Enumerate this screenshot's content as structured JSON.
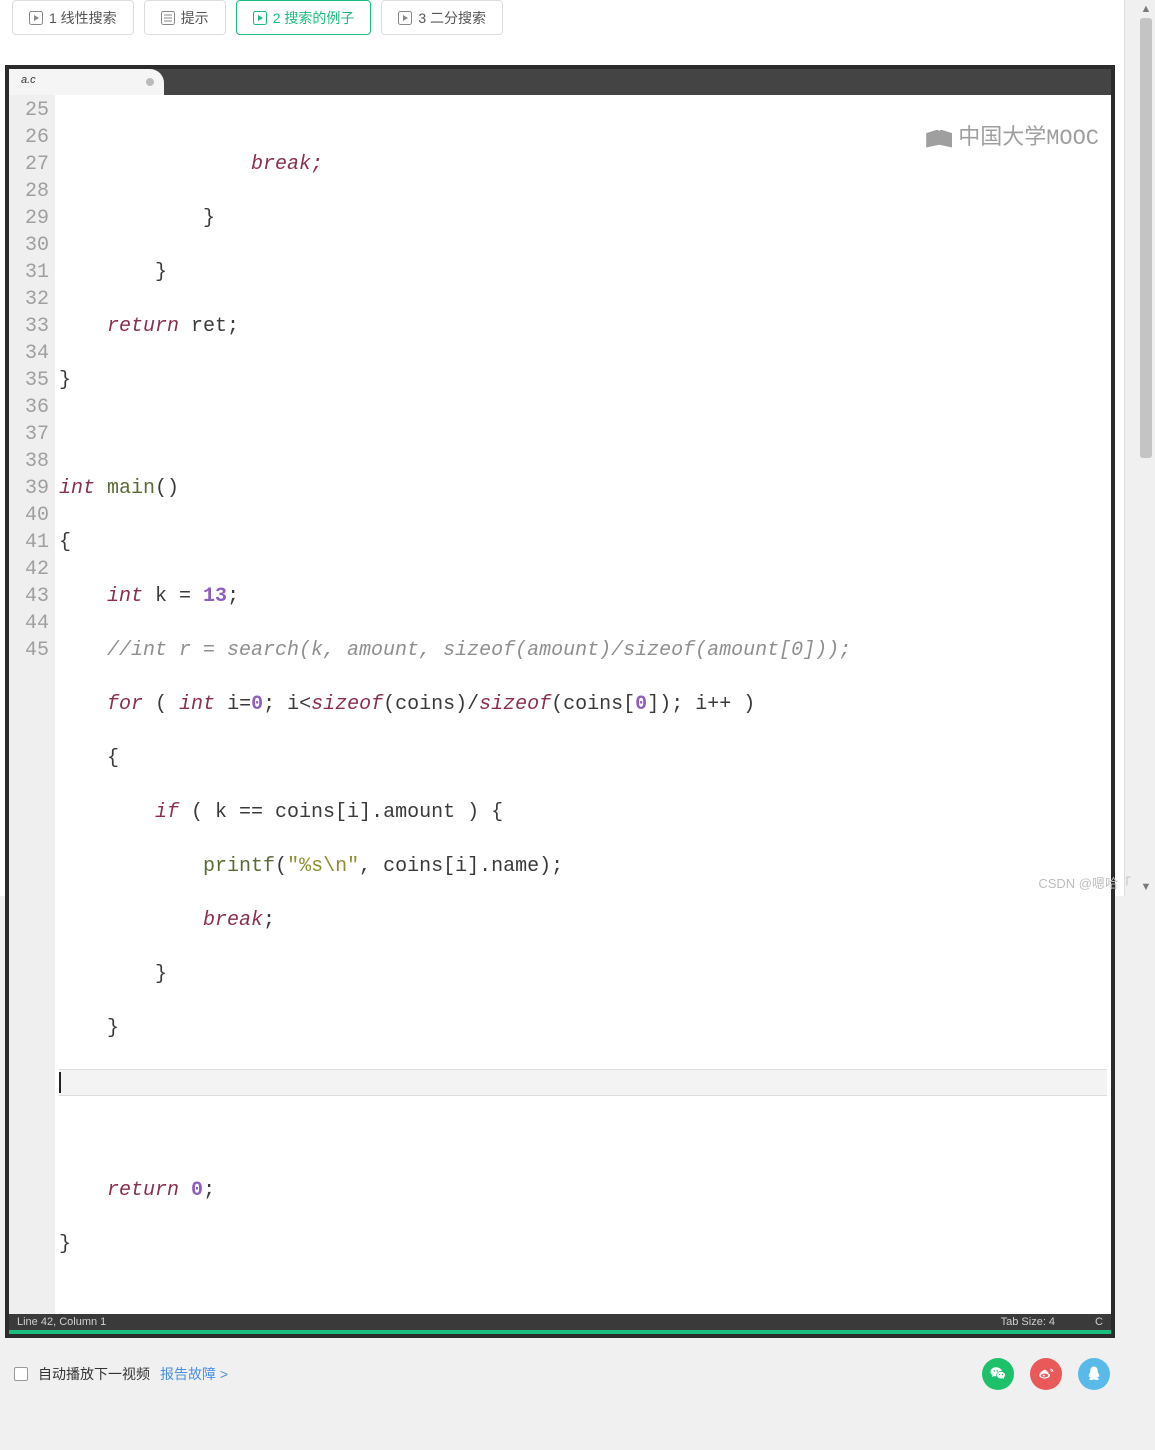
{
  "tabs": [
    {
      "label": "1 线性搜索",
      "kind": "play",
      "active": false
    },
    {
      "label": "提示",
      "kind": "list",
      "active": false
    },
    {
      "label": "2 搜索的例子",
      "kind": "play",
      "active": true
    },
    {
      "label": "3 二分搜索",
      "kind": "play",
      "active": false
    }
  ],
  "editor": {
    "tab_name": "a.c",
    "line_start": 25,
    "line_end": 45,
    "cursor_line": 42,
    "watermark": "中国大学MOOC",
    "status_left": "Line 42, Column 1",
    "status_tab": "Tab Size: 4",
    "status_lang": "C",
    "code": {
      "l25": "                break;",
      "l26": "            }",
      "l27": "        }",
      "l28_a": "    ",
      "l28_kw": "return",
      "l28_b": " ret;",
      "l29": "}",
      "l30": "",
      "l31_kw": "int",
      "l31_b": " ",
      "l31_fn": "main",
      "l31_c": "()",
      "l32": "{",
      "l33_a": "    ",
      "l33_kw": "int",
      "l33_b": " k = ",
      "l33_num": "13",
      "l33_c": ";",
      "l34": "    //int r = search(k, amount, sizeof(amount)/sizeof(amount[0]));",
      "l35_a": "    ",
      "l35_kw1": "for",
      "l35_b": " ( ",
      "l35_kw2": "int",
      "l35_c": " i=",
      "l35_n1": "0",
      "l35_d": "; i<",
      "l35_sz1": "sizeof",
      "l35_e": "(coins)/",
      "l35_sz2": "sizeof",
      "l35_f": "(coins[",
      "l35_n2": "0",
      "l35_g": "]); i++ )",
      "l36": "    {",
      "l37_a": "        ",
      "l37_kw": "if",
      "l37_b": " ( k == coins[i].amount ) {",
      "l38_a": "            ",
      "l38_fn": "printf",
      "l38_b": "(",
      "l38_s": "\"%s\\n\"",
      "l38_c": ", coins[i].name);",
      "l39_a": "            ",
      "l39_kw": "break",
      "l39_b": ";",
      "l40": "        }",
      "l41": "    }",
      "l42": "",
      "l43": "",
      "l44_a": "    ",
      "l44_kw": "return",
      "l44_b": " ",
      "l44_n": "0",
      "l44_c": ";",
      "l45": "}"
    }
  },
  "footer": {
    "autoplay_label": "自动播放下一视频",
    "report_label": "报告故障 >"
  },
  "watermark_csdn": "CSDN @嗯哈「"
}
